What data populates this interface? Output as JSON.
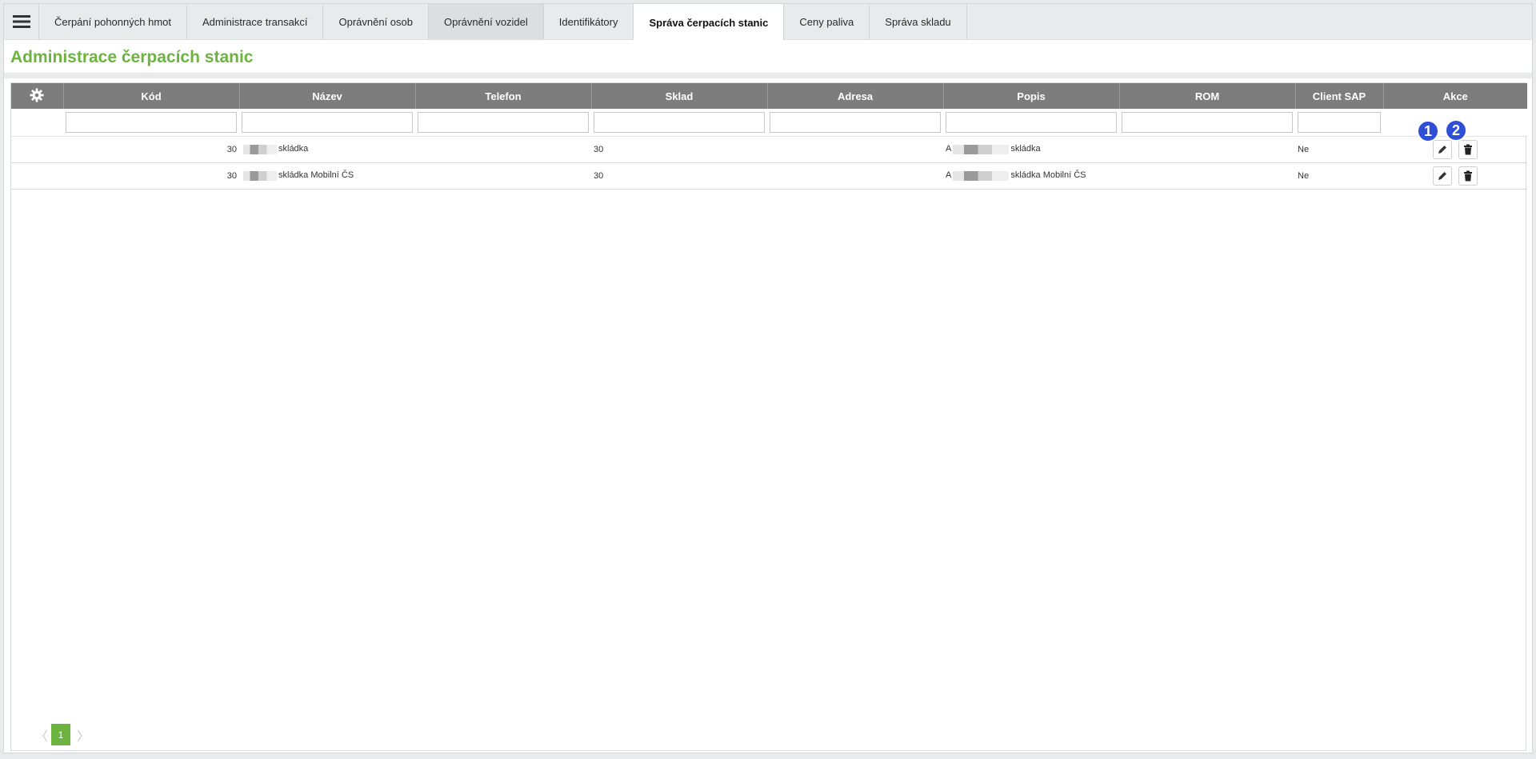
{
  "nav": {
    "tabs": [
      {
        "label": "Čerpání pohonných hmot"
      },
      {
        "label": "Administrace transakcí"
      },
      {
        "label": "Oprávnění osob"
      },
      {
        "label": "Oprávnění vozidel"
      },
      {
        "label": "Identifikátory"
      },
      {
        "label": "Správa čerpacích stanic"
      },
      {
        "label": "Ceny paliva"
      },
      {
        "label": "Správa skladu"
      }
    ],
    "active_tab": "Správa čerpacích stanic"
  },
  "page": {
    "title": "Administrace čerpacích stanic"
  },
  "table": {
    "columns": [
      "Kód",
      "Název",
      "Telefon",
      "Sklad",
      "Adresa",
      "Popis",
      "ROM",
      "Client SAP",
      "Akce"
    ],
    "rows": [
      {
        "kod": "30",
        "nazev": "skládka",
        "telefon": "",
        "sklad": "30",
        "adresa": "",
        "popis_prefix": "A",
        "popis": "skládka",
        "rom": "",
        "client_sap": "Ne"
      },
      {
        "kod": "30",
        "nazev": "skládka Mobilní ČS",
        "telefon": "",
        "sklad": "30",
        "adresa": "",
        "popis_prefix": "A",
        "popis": "skládka Mobilní ČS",
        "rom": "",
        "client_sap": "Ne"
      }
    ]
  },
  "annotations": {
    "badge1": "1",
    "badge2": "2"
  },
  "pagination": {
    "current_page": "1",
    "prev": "〈",
    "next": "〉"
  },
  "colors": {
    "accent": "#6cb33f",
    "header_bg": "#7d7d7d",
    "badge": "#2f4fd6"
  },
  "icons": {
    "menu": "hamburger-icon",
    "settings": "gear-icon",
    "edit": "pencil-icon",
    "delete": "trash-icon"
  }
}
